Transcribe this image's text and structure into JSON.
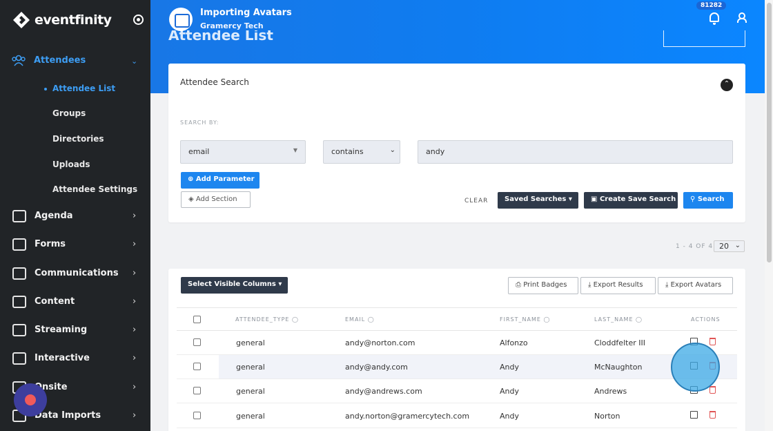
{
  "app": {
    "brand": "eventfinity",
    "accent": "#3d9df3"
  },
  "sidebar": {
    "attendees_label": "Attendees",
    "sub_items": [
      {
        "label": "Attendee List",
        "active": true
      },
      {
        "label": "Groups"
      },
      {
        "label": "Directories"
      },
      {
        "label": "Uploads"
      },
      {
        "label": "Attendee Settings"
      }
    ],
    "items": [
      {
        "label": "Agenda",
        "icon": "calendar-icon"
      },
      {
        "label": "Forms",
        "icon": "forms-icon"
      },
      {
        "label": "Communications",
        "icon": "mail-icon"
      },
      {
        "label": "Content",
        "icon": "image-icon"
      },
      {
        "label": "Streaming",
        "icon": "video-icon"
      },
      {
        "label": "Interactive",
        "icon": "share-icon"
      },
      {
        "label": "Onsite",
        "icon": "badge-icon"
      },
      {
        "label": "Data Imports",
        "icon": "upload-icon"
      }
    ]
  },
  "header": {
    "event_title": "Importing Avatars",
    "event_subtitle": "Gramercy Tech",
    "page_title": "Attendee List",
    "notification_count": "81282"
  },
  "search": {
    "title": "Attendee Search",
    "search_by_label": "SEARCH BY:",
    "field": "email",
    "operator": "contains",
    "value": "andy",
    "add_parameter": "Add Parameter",
    "add_section": "Add Section",
    "clear": "CLEAR",
    "saved_searches": "Saved Searches",
    "create_save_search": "Create Save Search",
    "search_button": "Search"
  },
  "pagination": {
    "range": "1 - 4 OF 4",
    "per_page": "20"
  },
  "table": {
    "select_columns": "Select Visible Columns",
    "print_badges": "Print Badges",
    "export_results": "Export Results",
    "export_avatars": "Export Avatars",
    "columns": [
      "ATTENDEE_TYPE",
      "EMAIL",
      "FIRST_NAME",
      "LAST_NAME",
      "ACTIONS"
    ],
    "rows": [
      {
        "type": "general",
        "email": "andy@norton.com",
        "first": "Alfonzo",
        "last": "Cloddfelter III"
      },
      {
        "type": "general",
        "email": "andy@andy.com",
        "first": "Andy",
        "last": "McNaughton"
      },
      {
        "type": "general",
        "email": "andy@andrews.com",
        "first": "Andy",
        "last": "Andrews"
      },
      {
        "type": "general",
        "email": "andy.norton@gramercytech.com",
        "first": "Andy",
        "last": "Norton"
      }
    ]
  }
}
